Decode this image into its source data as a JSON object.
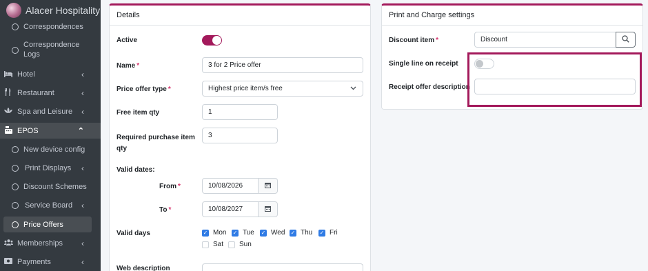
{
  "app": {
    "brand": "Alacer Hospitality"
  },
  "sidebar": {
    "items": [
      {
        "label": "Correspondences",
        "icon": "circle-icon"
      },
      {
        "label": "Correspondence",
        "label2": "Logs",
        "icon": "circle-icon"
      },
      {
        "label": "Hotel",
        "icon": "bed-icon",
        "chevron": "‹"
      },
      {
        "label": "Restaurant",
        "icon": "utensils-icon",
        "chevron": "‹"
      },
      {
        "label": "Spa and Leisure",
        "icon": "spa-icon",
        "chevron": "‹"
      },
      {
        "label": "EPOS",
        "icon": "cash-register-icon",
        "chevron": "⌃"
      },
      {
        "label": "New device config",
        "icon": "circle-icon"
      },
      {
        "label": "Print Displays",
        "icon": "circle-icon",
        "chevron": "‹"
      },
      {
        "label": "Discount Schemes",
        "icon": "circle-icon"
      },
      {
        "label": "Service Board",
        "icon": "circle-icon",
        "chevron": "‹"
      },
      {
        "label": "Price Offers",
        "icon": "circle-icon"
      },
      {
        "label": "Memberships",
        "icon": "users-icon",
        "chevron": "‹"
      },
      {
        "label": "Payments",
        "icon": "money-icon",
        "chevron": "‹"
      }
    ]
  },
  "details": {
    "title": "Details",
    "active_label": "Active",
    "active_value": "on",
    "name_label": "Name",
    "name_value": "3 for 2 Price offer",
    "offer_type_label": "Price offer type",
    "offer_type_value": "Highest price item/s free",
    "free_qty_label": "Free item qty",
    "free_qty_value": "1",
    "required_qty_label_1": "Required purchase item",
    "required_qty_label_2": "qty",
    "required_qty_value": "3",
    "valid_dates_label": "Valid dates:",
    "from_label": "From",
    "from_value": "10/08/2026",
    "to_label": "To",
    "to_value": "10/08/2027",
    "valid_days_label": "Valid days",
    "days": [
      {
        "label": "Mon",
        "checked": true
      },
      {
        "label": "Tue",
        "checked": true
      },
      {
        "label": "Wed",
        "checked": true
      },
      {
        "label": "Thu",
        "checked": true
      },
      {
        "label": "Fri",
        "checked": true
      },
      {
        "label": "Sat",
        "checked": false
      },
      {
        "label": "Sun",
        "checked": false
      }
    ],
    "web_description_label": "Web description",
    "required_marker": "*"
  },
  "print_settings": {
    "title": "Print and Charge settings",
    "discount_item_label": "Discount item",
    "discount_item_value": "Discount",
    "single_line_label": "Single line on receipt",
    "single_line_value": "off",
    "receipt_desc_label": "Receipt offer description",
    "receipt_desc_value": ""
  },
  "colors": {
    "accent": "#a3195b",
    "checkbox": "#2f7be5",
    "sidebar": "#343a40"
  }
}
